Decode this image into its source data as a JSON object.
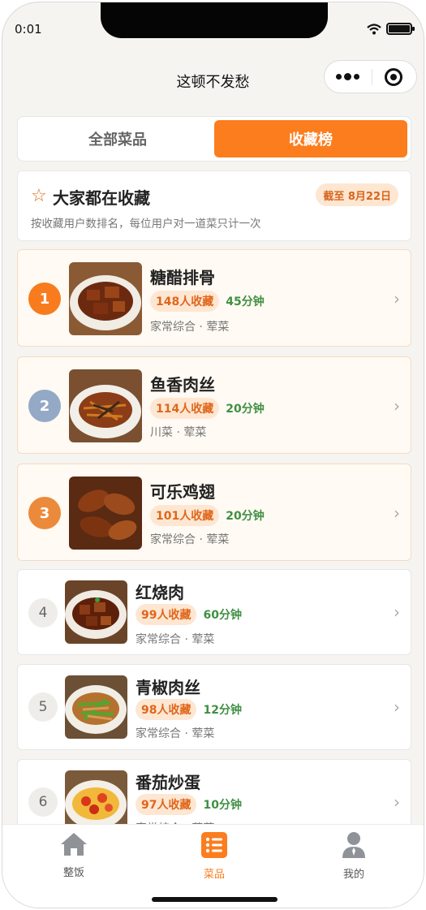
{
  "status": {
    "time": "0:01"
  },
  "nav": {
    "title": "这顿不发愁"
  },
  "tabs": [
    {
      "label": "全部菜品",
      "active": false
    },
    {
      "label": "收藏榜",
      "active": true
    }
  ],
  "intro": {
    "title": "大家都在收藏",
    "badge": "截至 8月22日",
    "desc": "按收藏用户数排名，每位用户对一道菜只计一次"
  },
  "ranks": [
    {
      "rank": "1",
      "name": "糖醋排骨",
      "favorites": "148人收藏",
      "time": "45分钟",
      "tags": "家常综合 · 荤菜",
      "color": "#f87c1d"
    },
    {
      "rank": "2",
      "name": "鱼香肉丝",
      "favorites": "114人收藏",
      "time": "20分钟",
      "tags": "川菜 · 荤菜",
      "color": "#93a9c6"
    },
    {
      "rank": "3",
      "name": "可乐鸡翅",
      "favorites": "101人收藏",
      "time": "20分钟",
      "tags": "家常综合 · 荤菜",
      "color": "#ec8a3b"
    },
    {
      "rank": "4",
      "name": "红烧肉",
      "favorites": "99人收藏",
      "time": "60分钟",
      "tags": "家常综合 · 荤菜"
    },
    {
      "rank": "5",
      "name": "青椒肉丝",
      "favorites": "98人收藏",
      "time": "12分钟",
      "tags": "家常综合 · 荤菜"
    },
    {
      "rank": "6",
      "name": "番茄炒蛋",
      "favorites": "97人收藏",
      "time": "10分钟",
      "tags": "家常综合 · 荤菜"
    }
  ],
  "tabbar": [
    {
      "label": "整饭",
      "icon": "home-icon",
      "active": false
    },
    {
      "label": "菜品",
      "icon": "list-icon",
      "active": true
    },
    {
      "label": "我的",
      "icon": "user-icon",
      "active": false
    }
  ],
  "colors": {
    "accent": "#fb7d1e",
    "time_green": "#3f8f43"
  }
}
